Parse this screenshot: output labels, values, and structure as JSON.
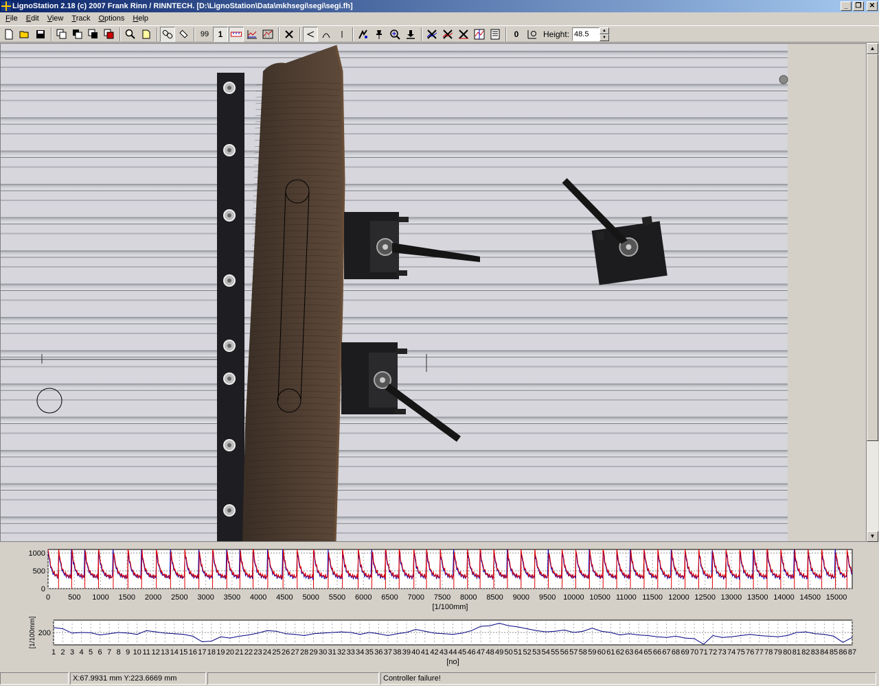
{
  "window": {
    "title": "LignoStation 2.18 (c) 2007 Frank Rinn / RINNTECH.  [D:\\LignoStation\\Data\\mkhsegi\\segi\\segi.fh]",
    "minimize_label": "_",
    "restore_label": "❐",
    "close_label": "✕"
  },
  "menu": [
    {
      "label": "File",
      "key": "F",
      "rest": "ile"
    },
    {
      "label": "Edit",
      "key": "E",
      "rest": "dit"
    },
    {
      "label": "View",
      "key": "V",
      "rest": "iew"
    },
    {
      "label": "Track",
      "key": "T",
      "rest": "rack"
    },
    {
      "label": "Options",
      "key": "O",
      "rest": "ptions"
    },
    {
      "label": "Help",
      "key": "H",
      "rest": "elp"
    }
  ],
  "toolbar": {
    "count_99": "99",
    "count_1": "1",
    "zero": "0",
    "height_label": "Height:",
    "height_value": "48.5"
  },
  "chart_data": [
    {
      "type": "line",
      "xlabel": "[1/100mm]",
      "ylabel": "",
      "x_ticks": [
        "0",
        "500",
        "1000",
        "1500",
        "2000",
        "2500",
        "3000",
        "3500",
        "4000",
        "4500",
        "5000",
        "5500",
        "6000",
        "6500",
        "7000",
        "7500",
        "8000",
        "8500",
        "9000",
        "9500",
        "10000",
        "10500",
        "11000",
        "11500",
        "12000",
        "12500",
        "13000",
        "13500",
        "14000",
        "14500",
        "15000"
      ],
      "y_ticks": [
        "0",
        "500",
        "1000"
      ],
      "xlim": [
        0,
        15300
      ],
      "ylim": [
        0,
        1100
      ],
      "grid": true,
      "series_colors": [
        "#e00000",
        "#0000c0"
      ],
      "ring_boundaries": [
        200,
        450,
        700,
        960,
        1240,
        1520,
        1780,
        2060,
        2330,
        2600,
        2870,
        3130,
        3400,
        3650,
        3900,
        4180,
        4470,
        4740,
        5050,
        5330,
        5600,
        5900,
        6160,
        6420,
        6680,
        6960,
        7200,
        7460,
        7720,
        7980,
        8220,
        8480,
        8740,
        9000,
        9260,
        9520,
        9780,
        10040,
        10300,
        10560,
        10820,
        11080,
        11340,
        11600,
        11860,
        12120,
        12380,
        12640,
        12900,
        13160,
        13420,
        13680,
        13940,
        14200,
        14460,
        14720,
        14980,
        15200
      ]
    },
    {
      "type": "line",
      "xlabel": "[no]",
      "ylabel": "[1/100mm]",
      "y_ticks": [
        "200"
      ],
      "ylim": [
        100,
        300
      ],
      "xlim": [
        1,
        87
      ],
      "grid": true,
      "series_colors": [
        "#000080"
      ],
      "x": [
        1,
        2,
        3,
        4,
        5,
        6,
        7,
        8,
        9,
        10,
        11,
        12,
        13,
        14,
        15,
        16,
        17,
        18,
        19,
        20,
        21,
        22,
        23,
        24,
        25,
        26,
        27,
        28,
        29,
        30,
        31,
        32,
        33,
        34,
        35,
        36,
        37,
        38,
        39,
        40,
        41,
        42,
        43,
        44,
        45,
        46,
        47,
        48,
        49,
        50,
        51,
        52,
        53,
        54,
        55,
        56,
        57,
        58,
        59,
        60,
        61,
        62,
        63,
        64,
        65,
        66,
        67,
        68,
        69,
        70,
        71,
        72,
        73,
        74,
        75,
        76,
        77,
        78,
        79,
        80,
        81,
        82,
        83,
        84,
        85,
        86,
        87
      ],
      "values": [
        240,
        230,
        195,
        200,
        198,
        180,
        190,
        200,
        195,
        185,
        215,
        205,
        195,
        190,
        185,
        170,
        125,
        130,
        165,
        155,
        170,
        180,
        195,
        215,
        210,
        190,
        185,
        175,
        190,
        195,
        200,
        205,
        200,
        185,
        200,
        190,
        175,
        190,
        200,
        225,
        210,
        195,
        190,
        185,
        195,
        215,
        250,
        255,
        275,
        255,
        245,
        230,
        215,
        205,
        210,
        220,
        200,
        210,
        235,
        210,
        200,
        180,
        190,
        180,
        175,
        165,
        160,
        170,
        155,
        150,
        105,
        175,
        160,
        165,
        175,
        185,
        175,
        170,
        165,
        175,
        200,
        205,
        190,
        185,
        170,
        120,
        160
      ]
    }
  ],
  "statusbar": {
    "cell1": "",
    "coords": "X:67.9931 mm  Y:223.6669 mm",
    "cell3": "",
    "message": "Controller failure!"
  }
}
